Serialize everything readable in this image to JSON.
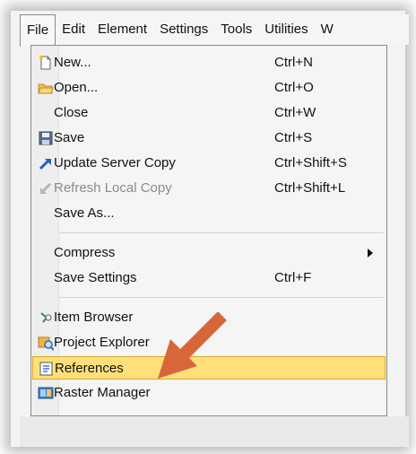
{
  "menubar": {
    "items": [
      {
        "label": "File",
        "active": true
      },
      {
        "label": "Edit"
      },
      {
        "label": "Element"
      },
      {
        "label": "Settings"
      },
      {
        "label": "Tools"
      },
      {
        "label": "Utilities"
      },
      {
        "label": "W"
      }
    ]
  },
  "file_menu": {
    "items": [
      {
        "label": "New...",
        "shortcut": "Ctrl+N",
        "icon": "new-file-icon"
      },
      {
        "label": "Open...",
        "shortcut": "Ctrl+O",
        "icon": "open-folder-icon"
      },
      {
        "label": "Close",
        "shortcut": "Ctrl+W",
        "icon": ""
      },
      {
        "label": "Save",
        "shortcut": "Ctrl+S",
        "icon": "floppy-disk-icon"
      },
      {
        "label": "Update Server Copy",
        "shortcut": "Ctrl+Shift+S",
        "icon": "upload-arrow-icon"
      },
      {
        "label": "Refresh Local Copy",
        "shortcut": "Ctrl+Shift+L",
        "icon": "download-arrow-icon",
        "disabled": true
      },
      {
        "label": "Save As...",
        "shortcut": "",
        "icon": ""
      },
      {
        "label": "Compress",
        "shortcut": "",
        "submenu": true
      },
      {
        "label": "Save Settings",
        "shortcut": "Ctrl+F"
      },
      {
        "label": "Item Browser",
        "icon": "item-browser-icon"
      },
      {
        "label": "Project Explorer",
        "icon": "project-explorer-icon"
      },
      {
        "label": "References",
        "icon": "references-icon",
        "highlighted": true
      },
      {
        "label": "Raster Manager",
        "icon": "raster-manager-icon"
      }
    ]
  },
  "colors": {
    "highlight": "#ffdf7a",
    "highlight_border": "#d9a72e",
    "callout_arrow": "#d9663a"
  }
}
